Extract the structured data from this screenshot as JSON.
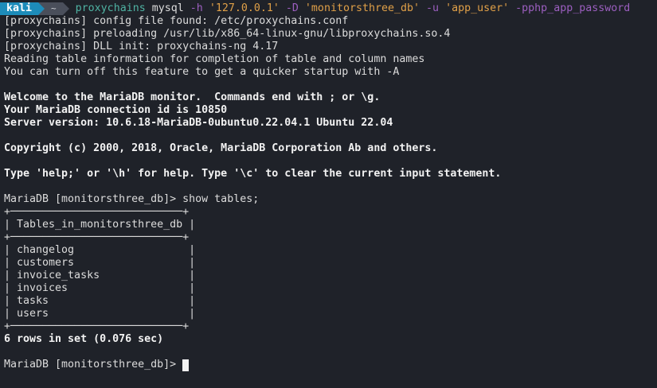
{
  "prompt": {
    "user": "kali",
    "dir": "~"
  },
  "command": {
    "program": "proxychains",
    "binary": "mysql",
    "flag_h": "-h",
    "host": "'127.0.0.1'",
    "flag_d": "-D",
    "database": "'monitorsthree_db'",
    "flag_u": "-u",
    "user": "'app_user'",
    "password_arg": "-pphp_app_password"
  },
  "output": {
    "l1": "[proxychains] config file found: /etc/proxychains.conf",
    "l2": "[proxychains] preloading /usr/lib/x86_64-linux-gnu/libproxychains.so.4",
    "l3": "[proxychains] DLL init: proxychains-ng 4.17",
    "l4": "Reading table information for completion of table and column names",
    "l5": "You can turn off this feature to get a quicker startup with -A",
    "welcome": "Welcome to the MariaDB monitor.  Commands end with ; or \\g.",
    "conn_id": "Your MariaDB connection id is 10850",
    "server": "Server version: 10.6.18-MariaDB-0ubuntu0.22.04.1 Ubuntu 22.04",
    "copyright": "Copyright (c) 2000, 2018, Oracle, MariaDB Corporation Ab and others.",
    "help": "Type 'help;' or '\\h' for help. Type '\\c' to clear the current input statement.",
    "query_prompt": "MariaDB [monitorsthree_db]> show tables;",
    "table_border": "+───────────────────────────+",
    "table_header": "| Tables_in_monitorsthree_db |",
    "rows": [
      "| changelog                  |",
      "| customers                  |",
      "| invoice_tasks              |",
      "| invoices                   |",
      "| tasks                      |",
      "| users                      |"
    ],
    "result": "6 rows in set (0.076 sec)",
    "final_prompt": "MariaDB [monitorsthree_db]> "
  }
}
